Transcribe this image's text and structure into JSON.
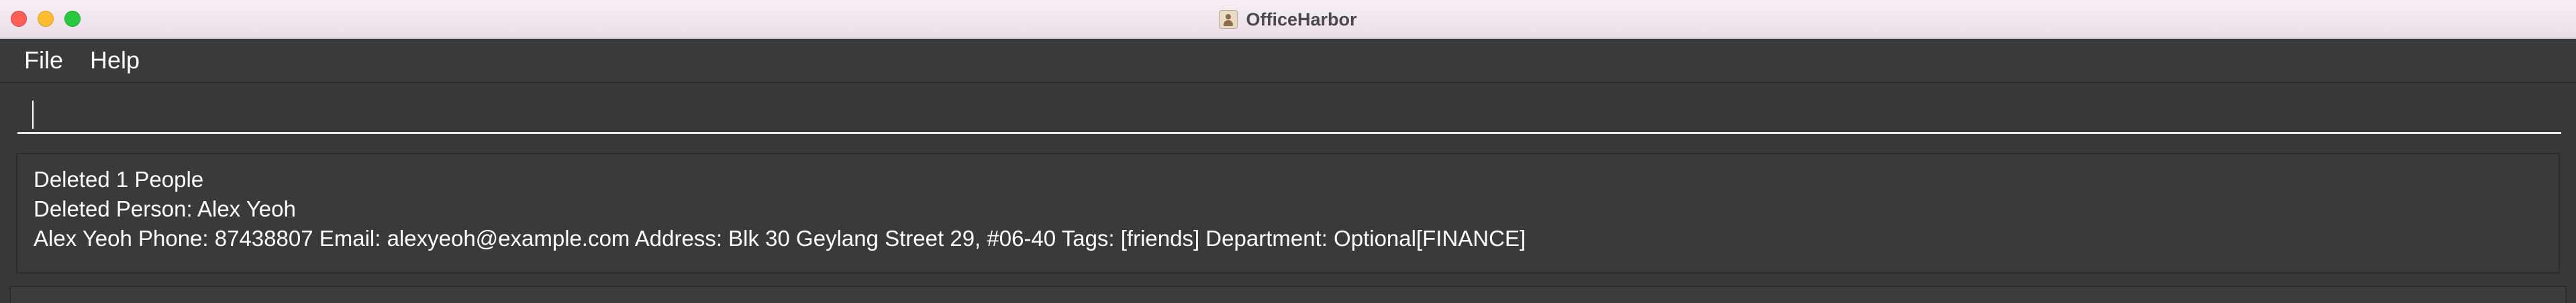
{
  "window": {
    "title": "OfficeHarbor",
    "app_icon": "person-card-icon"
  },
  "menu": {
    "items": [
      {
        "label": "File"
      },
      {
        "label": "Help"
      }
    ]
  },
  "command_box": {
    "value": "",
    "placeholder": ""
  },
  "result": {
    "lines": [
      "Deleted 1 People",
      "Deleted Person: Alex Yeoh",
      "Alex Yeoh Phone: 87438807 Email: alexyeoh@example.com Address: Blk 30 Geylang Street 29, #06-40 Tags: [friends] Department: Optional[FINANCE]"
    ]
  },
  "colors": {
    "background": "#383838",
    "text": "#ffffff",
    "titlebar": "#f3e9f1"
  }
}
